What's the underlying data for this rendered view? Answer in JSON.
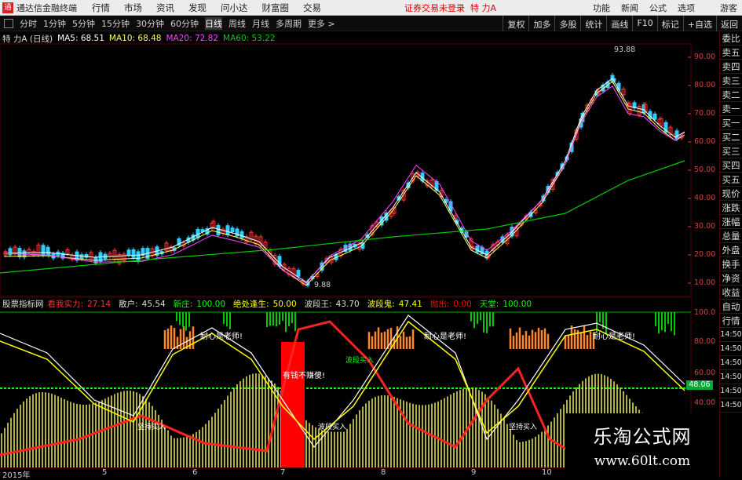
{
  "app": {
    "title": "通达信金融终端",
    "logo": "通",
    "menu": [
      "行情",
      "市场",
      "资讯",
      "发现",
      "问小达",
      "财富圈",
      "交易"
    ],
    "status": "证券交易未登录",
    "stock": "特 力A",
    "right": [
      "功能",
      "新闻",
      "公式",
      "选项",
      "游客"
    ]
  },
  "periods": [
    "分时",
    "1分钟",
    "5分钟",
    "15分钟",
    "30分钟",
    "60分钟",
    "日线",
    "周线",
    "月线",
    "多周期",
    "更多 >"
  ],
  "active_period": "日线",
  "toolbar_right": [
    "复权",
    "加多",
    "多股",
    "统计",
    "画线",
    "F10",
    "标记",
    "+自选",
    "返回"
  ],
  "main": {
    "name": "特 力A (日线)",
    "ma5": "MA5: 68.51",
    "ma10": "MA10: 68.48",
    "ma20": "MA20: 72.82",
    "ma60": "MA60: 53.22",
    "high_label": "93.88",
    "low_label": "9.88",
    "y_ticks": [
      "90.00",
      "80.00",
      "70.00",
      "60.00",
      "50.00",
      "40.00",
      "30.00",
      "20.00",
      "10.00"
    ]
  },
  "sub": {
    "name": "股票指标网",
    "items": [
      {
        "label": "看我实力:",
        "val": "27.14",
        "color": "#f33"
      },
      {
        "label": "散户:",
        "val": "45.54",
        "color": "#ddd"
      },
      {
        "label": "新庄:",
        "val": "100.00",
        "color": "#0f0"
      },
      {
        "label": "绝处逢生:",
        "val": "50.00",
        "color": "#ff0"
      },
      {
        "label": "波段王:",
        "val": "43.70",
        "color": "#ddd"
      },
      {
        "label": "波段鬼:",
        "val": "47.41",
        "color": "#ff0"
      },
      {
        "label": "抛出:",
        "val": "0.00",
        "color": "#f00"
      },
      {
        "label": "天堂:",
        "val": "100.00",
        "color": "#0f0"
      }
    ],
    "y_ticks": [
      "100.0",
      "80.00",
      "60.00",
      "40.00"
    ],
    "value_box": "48.06",
    "annotations": [
      "耐心是老师!",
      "耐心是老师!",
      "耐心是老师!",
      "有钱不赚傻!",
      "坚持买入",
      "坚持买入",
      "波段买入",
      "波段买入"
    ]
  },
  "right_panel": [
    "委比",
    "卖五",
    "卖四",
    "卖三",
    "卖二",
    "卖一",
    "买一",
    "买二",
    "买三",
    "买四",
    "买五",
    "现价",
    "涨跌",
    "涨幅",
    "总量",
    "外盘",
    "换手",
    "净资",
    "收益",
    "自动",
    "行情"
  ],
  "right_panel_time": [
    "14:50",
    "14:50",
    "14:50",
    "14:50",
    "14:50",
    "14:50"
  ],
  "dates": [
    "2015年",
    "5",
    "6",
    "7",
    "8",
    "9",
    "10"
  ],
  "watermark": {
    "title": "乐淘公式网",
    "url": "www.60lt.com"
  },
  "colors": {
    "up": "#ff3333",
    "down": "#33ccff",
    "ma5": "#ffffff",
    "ma10": "#ffff66",
    "ma20": "#ff44ff",
    "ma60": "#00cc00",
    "grid": "#550000"
  }
}
